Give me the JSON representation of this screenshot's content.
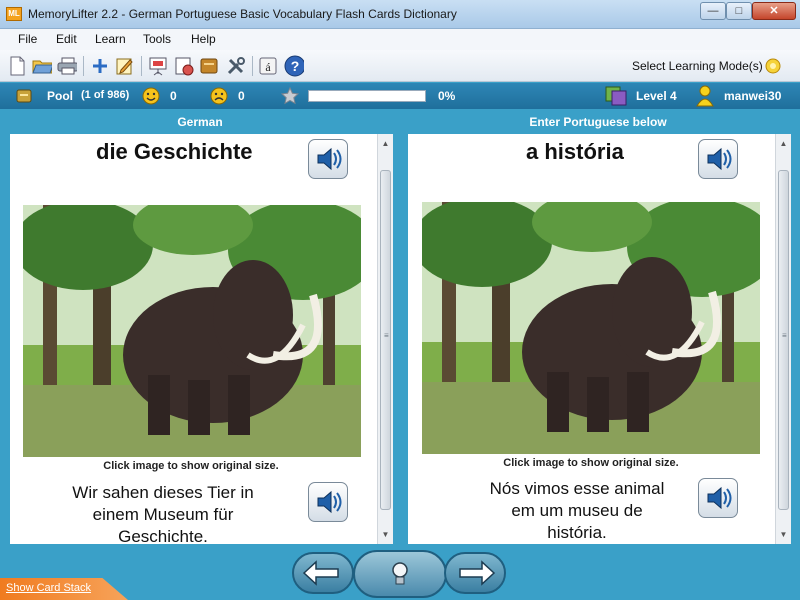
{
  "window": {
    "title": "MemoryLifter 2.2 - German Portuguese Basic Vocabulary Flash Cards Dictionary",
    "app_icon_text": "ML",
    "minimize": "—",
    "maximize": "□",
    "close": "✕"
  },
  "menu": {
    "items": [
      "File",
      "Edit",
      "Learn",
      "Tools",
      "Help"
    ]
  },
  "toolbar": {
    "mode_label": "Select Learning Mode(s)",
    "accent_key": "á",
    "help": "?"
  },
  "status": {
    "box": "Pool",
    "count": "(1 of 986)",
    "correct": "0",
    "wrong": "0",
    "progress_text": "0%",
    "progress_value": 0,
    "level": "Level 4",
    "user": "manwei30"
  },
  "left_panel": {
    "header": "German",
    "word": "die Geschichte",
    "image_hint": "Click image to show original size.",
    "sentence_lines": [
      "Wir sahen dieses Tier in",
      "einem Museum für",
      "Geschichte."
    ]
  },
  "right_panel": {
    "header": "Enter Portuguese below",
    "word": "a história",
    "image_hint": "Click image to show original size.",
    "sentence_lines": [
      "Nós vimos esse animal",
      "em um museu de",
      "história."
    ]
  },
  "bottom": {
    "show_card_stack": "Show Card Stack"
  },
  "colors": {
    "accent": "#3aa0c8",
    "status_bar": "#1f6f9c",
    "show_stack": "#f07b1f"
  }
}
